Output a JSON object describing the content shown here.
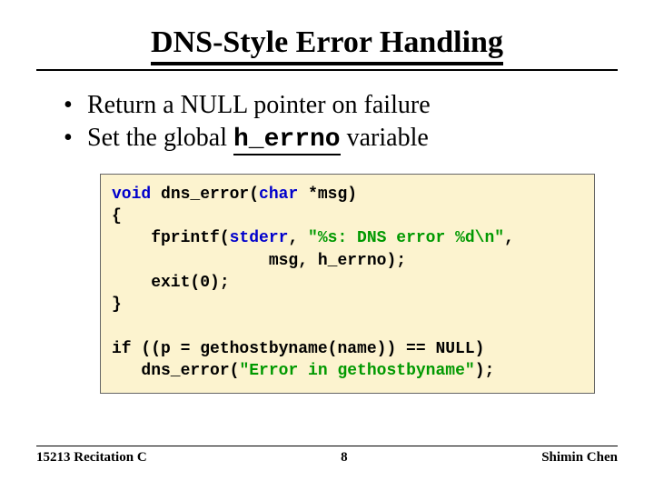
{
  "title": "DNS-Style Error Handling",
  "bullets": {
    "b1": "Return a NULL pointer on failure",
    "b2a": "Set the global ",
    "b2code": "h_errno",
    "b2b": " variable"
  },
  "code": {
    "kw_void": "void",
    "fn": " dns_error(",
    "kw_char": "char",
    "sig_end": " *msg)",
    "lbrace": "{",
    "indent1": "    fprintf(",
    "stderr": "stderr",
    "after_stderr": ", ",
    "fmt": "\"%s: DNS error %d\\n\"",
    "comma": ",",
    "line3": "                msg, h_errno);",
    "line4": "    exit(0);",
    "rbrace": "}",
    "blank": "",
    "if_a": "if ((p = gethostbyname(name)) == NULL)",
    "if_b_pre": "   dns_error(",
    "if_b_str": "\"Error in gethostbyname\"",
    "if_b_post": ");"
  },
  "footer": {
    "left": "15213 Recitation C",
    "center": "8",
    "right": "Shimin Chen"
  }
}
